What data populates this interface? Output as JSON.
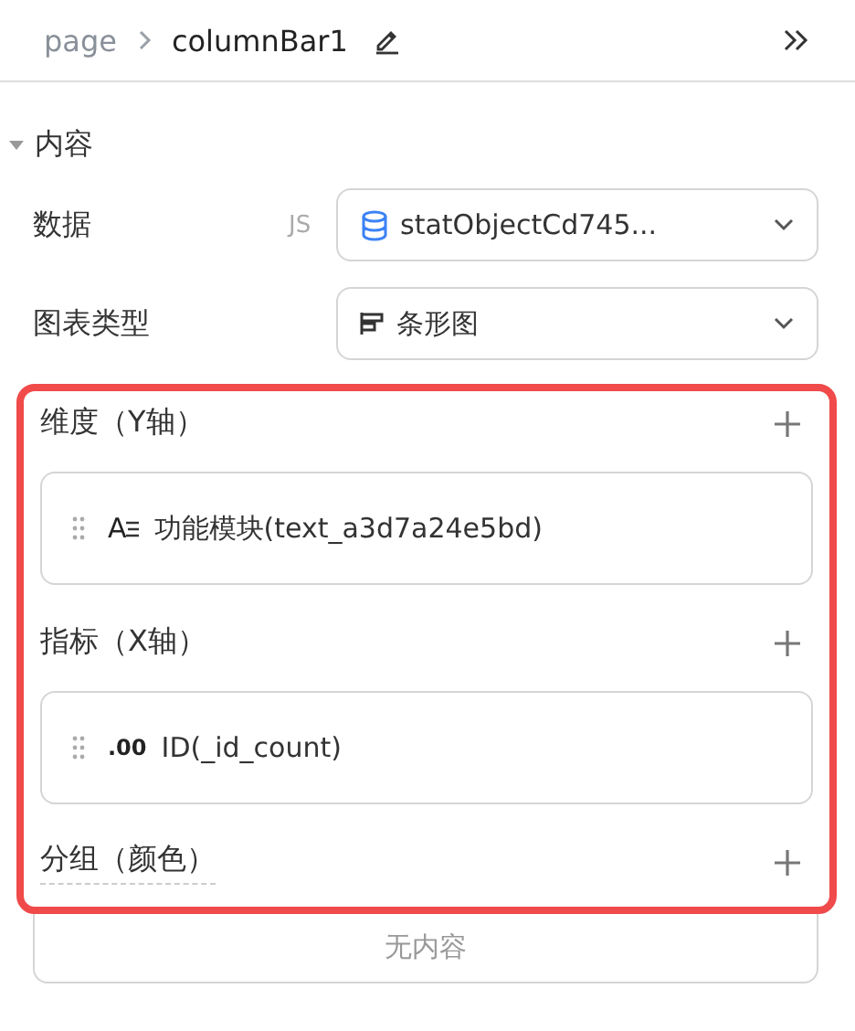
{
  "breadcrumb": {
    "parent": "page",
    "current": "columnBar1"
  },
  "section": {
    "title": "内容",
    "expanded": true
  },
  "fields": [
    {
      "label": "数据",
      "badge": "JS",
      "value": "statObjectCd745...",
      "kind": "datasource"
    },
    {
      "label": "图表类型",
      "value": "条形图",
      "kind": "charttype"
    }
  ],
  "highlighted": true,
  "groups": [
    {
      "title": "维度（Y轴）",
      "dashed": false,
      "items": [
        {
          "kind": "text",
          "mark": "A",
          "text": "功能模块(text_a3d7a24e5bd)"
        }
      ]
    },
    {
      "title": "指标（X轴）",
      "dashed": false,
      "items": [
        {
          "kind": "number",
          "mark": ".00",
          "text": "ID(_id_count)"
        }
      ]
    },
    {
      "title": "分组（颜色）",
      "dashed": true,
      "empty_text": "无内容"
    }
  ]
}
